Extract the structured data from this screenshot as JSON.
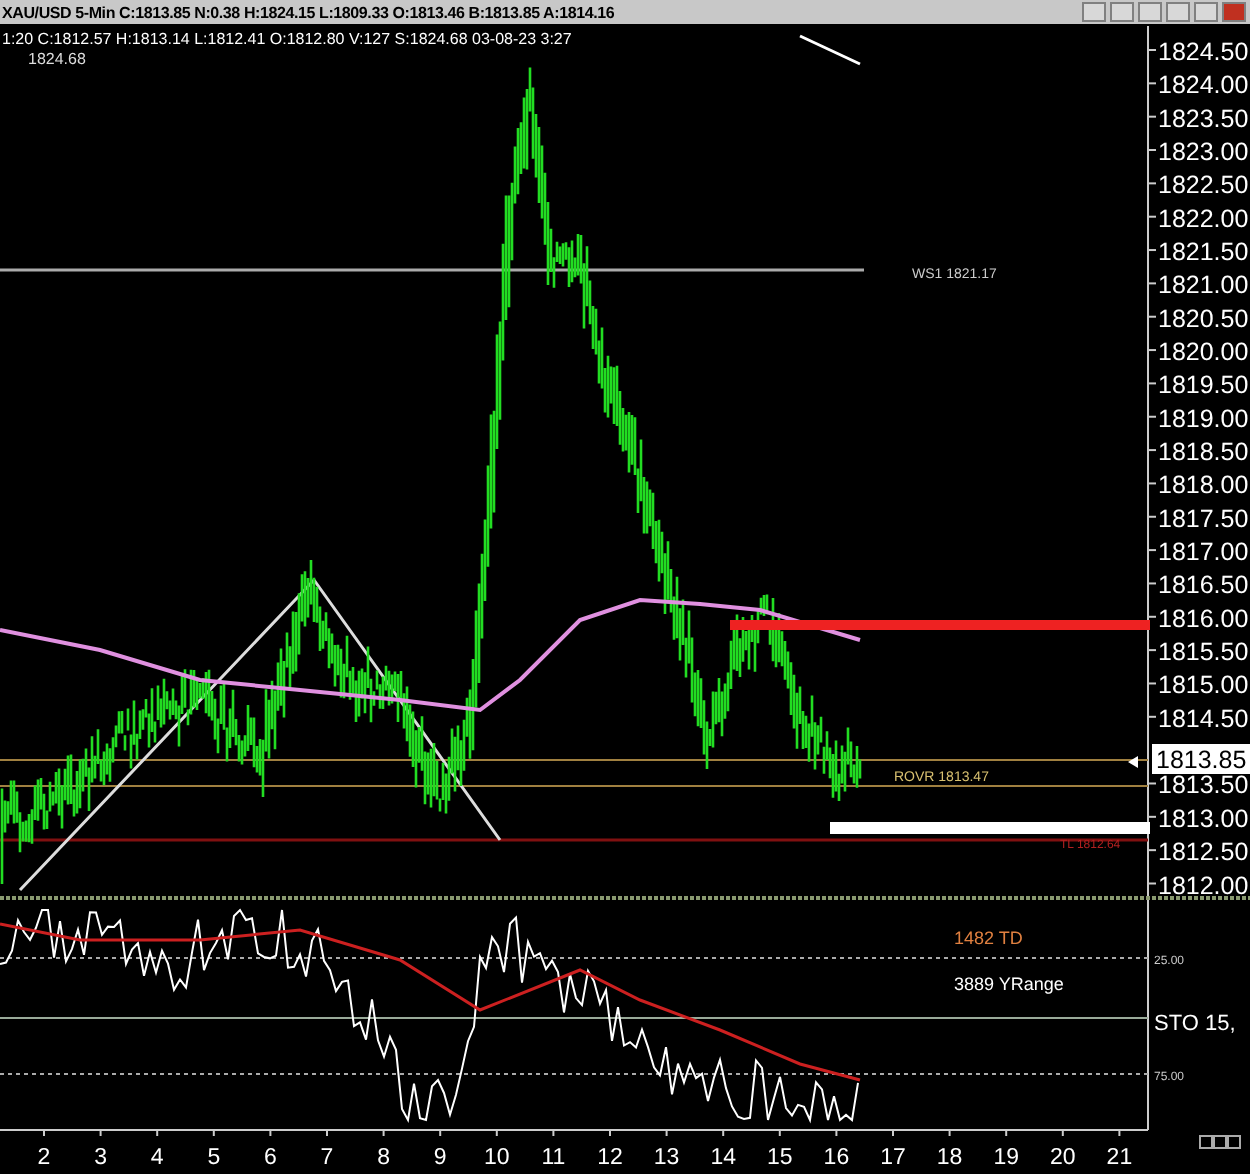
{
  "header": {
    "summary": "XAU/USD 5-Min C:1813.85 N:0.38 H:1824.15 L:1809.33 O:1813.46 B:1813.85 A:1814.16",
    "bar_info": "1:20 C:1812.57 H:1813.14 L:1812.41 O:1812.80 V:127 S:1824.68 03-08-23 3:27",
    "high_marker": "1824.68"
  },
  "price_panel": {
    "axis_labels": [
      "1824.50",
      "1824.00",
      "1823.50",
      "1823.00",
      "1822.50",
      "1822.00",
      "1821.50",
      "1821.00",
      "1820.50",
      "1820.00",
      "1819.50",
      "1819.00",
      "1818.50",
      "1818.00",
      "1817.50",
      "1817.00",
      "1816.50",
      "1816.00",
      "1815.50",
      "1815.00",
      "1814.50",
      "1813.50",
      "1813.00",
      "1812.50",
      "1812.00"
    ],
    "last_price": "1813.85",
    "levels": [
      {
        "kind": "pivot",
        "label": "WS1 1821.17"
      },
      {
        "kind": "rovr",
        "label": "ROVR 1813.47"
      },
      {
        "kind": "tl",
        "label": "TL 1812.64"
      }
    ]
  },
  "indicator_panel": {
    "td": "1482 TD",
    "yrange": "3889 YRange",
    "upper_label": "25.00",
    "study": "STO 15,",
    "lower_label": "75.00"
  },
  "time_axis": {
    "labels": [
      "2",
      "3",
      "4",
      "5",
      "6",
      "7",
      "8",
      "9",
      "10",
      "11",
      "12",
      "13",
      "14",
      "15",
      "16",
      "17",
      "18",
      "19",
      "20",
      "21"
    ]
  }
}
